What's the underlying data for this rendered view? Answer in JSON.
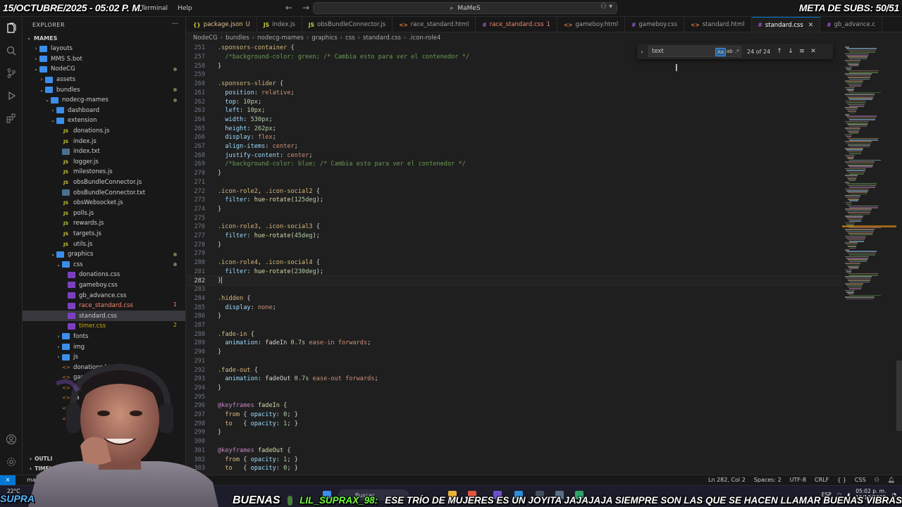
{
  "overlays": {
    "date": "15/OCTUBRE/2025 - 05:02 P. M.",
    "goal": "META DE SUBS: 50/51",
    "brand": "SUPRA",
    "ticker_prev": "BUENAS",
    "ticker_user": "LIL_SUPRAX_98:",
    "ticker_message": "ESE TRÍO DE MUJERES ES UN JOYITA JAJAJAJA SIEMPRE SON LAS QUE SE HACEN LLAMAR BUENAS VIBRAS"
  },
  "titlebar": {
    "menu": [
      "Terminal",
      "Help"
    ],
    "command_center": "MaMeS"
  },
  "sidebar": {
    "title": "EXPLORER",
    "workspace": "MAMES",
    "items": [
      {
        "label": "layouts",
        "type": "folder",
        "depth": 1,
        "expanded": false
      },
      {
        "label": "MMS S.bot",
        "type": "folder",
        "depth": 1,
        "expanded": false
      },
      {
        "label": "NodeCG",
        "type": "folder",
        "depth": 1,
        "expanded": true,
        "modified": true
      },
      {
        "label": "assets",
        "type": "folder",
        "depth": 2,
        "expanded": false
      },
      {
        "label": "bundles",
        "type": "folder",
        "depth": 2,
        "expanded": true,
        "modified": true
      },
      {
        "label": "nodecg-mames",
        "type": "folder",
        "depth": 3,
        "expanded": true,
        "modified": true
      },
      {
        "label": "dashboard",
        "type": "folder",
        "depth": 4,
        "expanded": false
      },
      {
        "label": "extension",
        "type": "folder",
        "depth": 4,
        "expanded": true
      },
      {
        "label": "donations.js",
        "type": "js",
        "depth": 5
      },
      {
        "label": "index.js",
        "type": "js",
        "depth": 5
      },
      {
        "label": "index.txt",
        "type": "txt",
        "depth": 5
      },
      {
        "label": "logger.js",
        "type": "js",
        "depth": 5
      },
      {
        "label": "milestones.js",
        "type": "js",
        "depth": 5
      },
      {
        "label": "obsBundleConnector.js",
        "type": "js",
        "depth": 5
      },
      {
        "label": "obsBundleConnector.txt",
        "type": "txt",
        "depth": 5
      },
      {
        "label": "obsWebsocket.js",
        "type": "js",
        "depth": 5
      },
      {
        "label": "polls.js",
        "type": "js",
        "depth": 5
      },
      {
        "label": "rewards.js",
        "type": "js",
        "depth": 5
      },
      {
        "label": "targets.js",
        "type": "js",
        "depth": 5
      },
      {
        "label": "utils.js",
        "type": "js",
        "depth": 5
      },
      {
        "label": "graphics",
        "type": "folder",
        "depth": 4,
        "expanded": true,
        "modified": true
      },
      {
        "label": "css",
        "type": "folder",
        "depth": 5,
        "expanded": true,
        "modified": true
      },
      {
        "label": "donations.css",
        "type": "css",
        "depth": 6
      },
      {
        "label": "gameboy.css",
        "type": "css",
        "depth": 6
      },
      {
        "label": "gb_advance.css",
        "type": "css",
        "depth": 6
      },
      {
        "label": "race_standard.css",
        "type": "css",
        "depth": 6,
        "status": "error",
        "badge": "1"
      },
      {
        "label": "standard.css",
        "type": "css",
        "depth": 6,
        "selected": true
      },
      {
        "label": "timer.css",
        "type": "css",
        "depth": 6,
        "status": "warn",
        "badge": "2"
      },
      {
        "label": "fonts",
        "type": "folder",
        "depth": 5,
        "expanded": false
      },
      {
        "label": "img",
        "type": "folder",
        "depth": 5,
        "expanded": false
      },
      {
        "label": "js",
        "type": "folder",
        "depth": 5,
        "expanded": false
      },
      {
        "label": "donations.html",
        "type": "html",
        "depth": 5
      },
      {
        "label": "gamel",
        "type": "html",
        "depth": 5
      },
      {
        "label": "gb_a",
        "type": "html",
        "depth": 5
      },
      {
        "label": "ra",
        "type": "html",
        "depth": 5
      },
      {
        "label": "st",
        "type": "html",
        "depth": 5
      },
      {
        "label": "ti",
        "type": "html",
        "depth": 5
      }
    ],
    "bottom": [
      "OUTLI",
      "TIMEL"
    ]
  },
  "tabs": [
    {
      "label": "package.json",
      "icon": "{}",
      "kind": "json",
      "suffix": "U"
    },
    {
      "label": "index.js",
      "icon": "JS",
      "kind": "js",
      "suffix": ""
    },
    {
      "label": "obsBundleConnector.js",
      "icon": "JS",
      "kind": "js",
      "suffix": ""
    },
    {
      "label": "race_standard.html",
      "icon": "<>",
      "kind": "html",
      "suffix": ""
    },
    {
      "label": "race_standard.css",
      "icon": "#",
      "kind": "css",
      "suffix": "1"
    },
    {
      "label": "gameboy.html",
      "icon": "<>",
      "kind": "html",
      "suffix": ""
    },
    {
      "label": "gameboy.css",
      "icon": "#",
      "kind": "css",
      "suffix": ""
    },
    {
      "label": "standard.html",
      "icon": "<>",
      "kind": "html",
      "suffix": ""
    },
    {
      "label": "standard.css",
      "icon": "#",
      "kind": "css",
      "suffix": "",
      "active": true
    },
    {
      "label": "gb_advance.c",
      "icon": "#",
      "kind": "css",
      "suffix": ""
    }
  ],
  "breadcrumb": [
    "NodeCG",
    "bundles",
    "nodecg-mames",
    "graphics",
    "css",
    "standard.css",
    ".icon-role4"
  ],
  "find": {
    "query": "text",
    "count": "24 of 24",
    "opt_case": "Aa",
    "opt_word": "ab",
    "opt_regex": ".*"
  },
  "editor": {
    "current_line": 282,
    "lines": [
      {
        "n": 251,
        "t": [
          [
            "sel",
            ".sponsors-container"
          ],
          [
            "br",
            " {"
          ]
        ]
      },
      {
        "n": 257,
        "t": [
          [
            "cmt",
            "  /*background-color: green; /* Cambia esto para ver el contenedor */"
          ]
        ]
      },
      {
        "n": 258,
        "t": [
          [
            "br",
            "}"
          ]
        ]
      },
      {
        "n": 259,
        "t": []
      },
      {
        "n": 260,
        "t": [
          [
            "sel",
            ".sponsors-slider"
          ],
          [
            "br",
            " {"
          ]
        ]
      },
      {
        "n": 261,
        "t": [
          [
            "prop",
            "  position"
          ],
          [
            "br",
            ": "
          ],
          [
            "val",
            "relative"
          ],
          [
            "br",
            ";"
          ]
        ]
      },
      {
        "n": 262,
        "t": [
          [
            "prop",
            "  top"
          ],
          [
            "br",
            ": "
          ],
          [
            "num",
            "10px"
          ],
          [
            "br",
            ";"
          ]
        ]
      },
      {
        "n": 263,
        "t": [
          [
            "prop",
            "  left"
          ],
          [
            "br",
            ": "
          ],
          [
            "num",
            "10px"
          ],
          [
            "br",
            ";"
          ]
        ]
      },
      {
        "n": 264,
        "t": [
          [
            "prop",
            "  width"
          ],
          [
            "br",
            ": "
          ],
          [
            "num",
            "530px"
          ],
          [
            "br",
            ";"
          ]
        ]
      },
      {
        "n": 265,
        "t": [
          [
            "prop",
            "  height"
          ],
          [
            "br",
            ": "
          ],
          [
            "num",
            "262px"
          ],
          [
            "br",
            ";"
          ]
        ]
      },
      {
        "n": 266,
        "t": [
          [
            "prop",
            "  display"
          ],
          [
            "br",
            ": "
          ],
          [
            "val",
            "flex"
          ],
          [
            "br",
            ";"
          ]
        ]
      },
      {
        "n": 267,
        "t": [
          [
            "prop",
            "  align-items"
          ],
          [
            "br",
            ": "
          ],
          [
            "val",
            "center"
          ],
          [
            "br",
            ";"
          ]
        ]
      },
      {
        "n": 268,
        "t": [
          [
            "prop",
            "  justify-content"
          ],
          [
            "br",
            ": "
          ],
          [
            "val",
            "center"
          ],
          [
            "br",
            ";"
          ]
        ]
      },
      {
        "n": 269,
        "t": [
          [
            "cmt",
            "  /*background-color: blue; /* Cambia esto para ver el contenedor */"
          ]
        ]
      },
      {
        "n": 270,
        "t": [
          [
            "br",
            "}"
          ]
        ]
      },
      {
        "n": 271,
        "t": []
      },
      {
        "n": 272,
        "t": [
          [
            "sel",
            ".icon-role2"
          ],
          [
            "br",
            ", "
          ],
          [
            "sel",
            ".icon-social2"
          ],
          [
            "br",
            " {"
          ]
        ]
      },
      {
        "n": 273,
        "t": [
          [
            "prop",
            "  filter"
          ],
          [
            "br",
            ": "
          ],
          [
            "fn",
            "hue-rotate"
          ],
          [
            "br",
            "("
          ],
          [
            "num",
            "125deg"
          ],
          [
            "br",
            ");"
          ]
        ]
      },
      {
        "n": 274,
        "t": [
          [
            "br",
            "}"
          ]
        ]
      },
      {
        "n": 275,
        "t": []
      },
      {
        "n": 276,
        "t": [
          [
            "sel",
            ".icon-role3"
          ],
          [
            "br",
            ", "
          ],
          [
            "sel",
            ".icon-social3"
          ],
          [
            "br",
            " {"
          ]
        ]
      },
      {
        "n": 277,
        "t": [
          [
            "prop",
            "  filter"
          ],
          [
            "br",
            ": "
          ],
          [
            "fn",
            "hue-rotate"
          ],
          [
            "br",
            "("
          ],
          [
            "num",
            "45deg"
          ],
          [
            "br",
            ");"
          ]
        ]
      },
      {
        "n": 278,
        "t": [
          [
            "br",
            "}"
          ]
        ]
      },
      {
        "n": 279,
        "t": []
      },
      {
        "n": 280,
        "t": [
          [
            "sel",
            ".icon-role4"
          ],
          [
            "br",
            ", "
          ],
          [
            "sel",
            ".icon-social4"
          ],
          [
            "br",
            " {"
          ]
        ]
      },
      {
        "n": 281,
        "t": [
          [
            "prop",
            "  filter"
          ],
          [
            "br",
            ": "
          ],
          [
            "fn",
            "hue-rotate"
          ],
          [
            "br",
            "("
          ],
          [
            "num",
            "230deg"
          ],
          [
            "br",
            ");"
          ]
        ]
      },
      {
        "n": 282,
        "t": [
          [
            "br",
            "}"
          ]
        ]
      },
      {
        "n": 283,
        "t": []
      },
      {
        "n": 284,
        "t": [
          [
            "sel",
            ".hidden"
          ],
          [
            "br",
            " {"
          ]
        ]
      },
      {
        "n": 285,
        "t": [
          [
            "prop",
            "  display"
          ],
          [
            "br",
            ": "
          ],
          [
            "val",
            "none"
          ],
          [
            "br",
            ";"
          ]
        ]
      },
      {
        "n": 286,
        "t": [
          [
            "br",
            "}"
          ]
        ]
      },
      {
        "n": 287,
        "t": []
      },
      {
        "n": 288,
        "t": [
          [
            "sel",
            ".fade-in"
          ],
          [
            "br",
            " {"
          ]
        ]
      },
      {
        "n": 289,
        "t": [
          [
            "prop",
            "  animation"
          ],
          [
            "br",
            ": fadeIn "
          ],
          [
            "num",
            "0.7s"
          ],
          [
            "val",
            " ease-in forwards"
          ],
          [
            "br",
            ";"
          ]
        ]
      },
      {
        "n": 290,
        "t": [
          [
            "br",
            "}"
          ]
        ]
      },
      {
        "n": 291,
        "t": []
      },
      {
        "n": 292,
        "t": [
          [
            "sel",
            ".fade-out"
          ],
          [
            "br",
            " {"
          ]
        ]
      },
      {
        "n": 293,
        "t": [
          [
            "prop",
            "  animation"
          ],
          [
            "br",
            ": fadeOut "
          ],
          [
            "num",
            "0.7s"
          ],
          [
            "val",
            " ease-out forwards"
          ],
          [
            "br",
            ";"
          ]
        ]
      },
      {
        "n": 294,
        "t": [
          [
            "br",
            "}"
          ]
        ]
      },
      {
        "n": 295,
        "t": []
      },
      {
        "n": 296,
        "t": [
          [
            "kw",
            "@keyframes"
          ],
          [
            "br",
            " "
          ],
          [
            "fn",
            "fadeIn"
          ],
          [
            "br",
            " {"
          ]
        ]
      },
      {
        "n": 297,
        "t": [
          [
            "sel",
            "  from"
          ],
          [
            "br",
            " { "
          ],
          [
            "prop",
            "opacity"
          ],
          [
            "br",
            ": "
          ],
          [
            "num",
            "0"
          ],
          [
            "br",
            "; }"
          ]
        ]
      },
      {
        "n": 298,
        "t": [
          [
            "sel",
            "  to"
          ],
          [
            "br",
            "   { "
          ],
          [
            "prop",
            "opacity"
          ],
          [
            "br",
            ": "
          ],
          [
            "num",
            "1"
          ],
          [
            "br",
            "; }"
          ]
        ]
      },
      {
        "n": 299,
        "t": [
          [
            "br",
            "}"
          ]
        ]
      },
      {
        "n": 300,
        "t": []
      },
      {
        "n": 301,
        "t": [
          [
            "kw",
            "@keyframes"
          ],
          [
            "br",
            " "
          ],
          [
            "fn",
            "fadeOut"
          ],
          [
            "br",
            " {"
          ]
        ]
      },
      {
        "n": 302,
        "t": [
          [
            "sel",
            "  from"
          ],
          [
            "br",
            " { "
          ],
          [
            "prop",
            "opacity"
          ],
          [
            "br",
            ": "
          ],
          [
            "num",
            "1"
          ],
          [
            "br",
            "; }"
          ]
        ]
      },
      {
        "n": 303,
        "t": [
          [
            "sel",
            "  to"
          ],
          [
            "br",
            "   { "
          ],
          [
            "prop",
            "opacity"
          ],
          [
            "br",
            ": "
          ],
          [
            "num",
            "0"
          ],
          [
            "br",
            "; }"
          ]
        ]
      }
    ]
  },
  "statusbar": {
    "branch": "mast",
    "position": "Ln 282, Col 2",
    "spaces": "Spaces: 2",
    "encoding": "UTF-8",
    "eol": "CRLF",
    "language": "CSS"
  },
  "taskbar": {
    "weather": "22°C",
    "search": "Buscar",
    "lang": "ESP",
    "time": "05:02 p. m.",
    "date": "15/10/2025"
  },
  "colors": {
    "accent": "#0078d4",
    "ticker_user": "#6fff3b",
    "overlay_text": "#ffffff"
  }
}
